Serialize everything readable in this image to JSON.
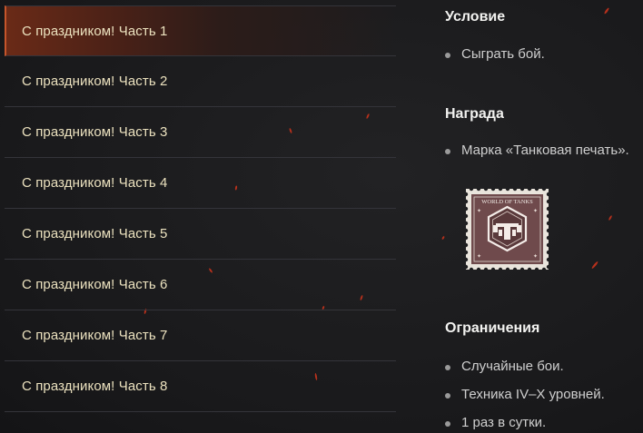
{
  "quests": [
    {
      "label": "С праздником! Часть 1",
      "active": true
    },
    {
      "label": "С праздником! Часть 2",
      "active": false
    },
    {
      "label": "С праздником! Часть 3",
      "active": false
    },
    {
      "label": "С праздником! Часть 4",
      "active": false
    },
    {
      "label": "С праздником! Часть 5",
      "active": false
    },
    {
      "label": "С праздником! Часть 6",
      "active": false
    },
    {
      "label": "С праздником! Часть 7",
      "active": false
    },
    {
      "label": "С праздником! Часть 8",
      "active": false
    }
  ],
  "condition": {
    "title": "Условие",
    "items": [
      "Сыграть бой."
    ]
  },
  "reward": {
    "title": "Награда",
    "items": [
      "Марка «Танковая печать»."
    ],
    "stamp": {
      "caption": "WORLD OF TANKS",
      "icon": "tank-stamp-icon"
    }
  },
  "restrictions": {
    "title": "Ограничения",
    "items": [
      "Случайные бои.",
      "Техника IV–X уровней.",
      "1 раз в сутки."
    ]
  },
  "colors": {
    "accent": "#c5552b",
    "quest_text": "#ece2bf",
    "stamp_bg": "#6f4a4c"
  }
}
